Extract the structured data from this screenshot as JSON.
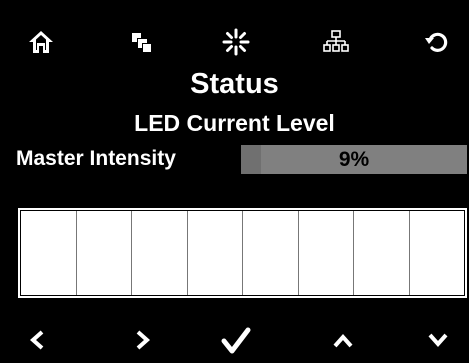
{
  "toolbar": {
    "icons": [
      "home-icon",
      "copy-icon",
      "brightness-icon",
      "network-icon",
      "refresh-icon"
    ]
  },
  "screen": {
    "title": "Status",
    "subtitle": "LED Current Level"
  },
  "master": {
    "label": "Master Intensity",
    "value_text": "9%",
    "value": 0.09
  },
  "channels": {
    "count": 8,
    "levels": [
      0,
      0,
      0,
      0,
      0,
      0,
      0,
      0
    ]
  },
  "navigation": {
    "icons": [
      "chevron-left-icon",
      "chevron-right-icon",
      "check-icon",
      "chevron-up-icon",
      "chevron-down-icon"
    ]
  },
  "colors": {
    "background": "#000000",
    "foreground": "#ffffff",
    "bar": "#808080"
  }
}
